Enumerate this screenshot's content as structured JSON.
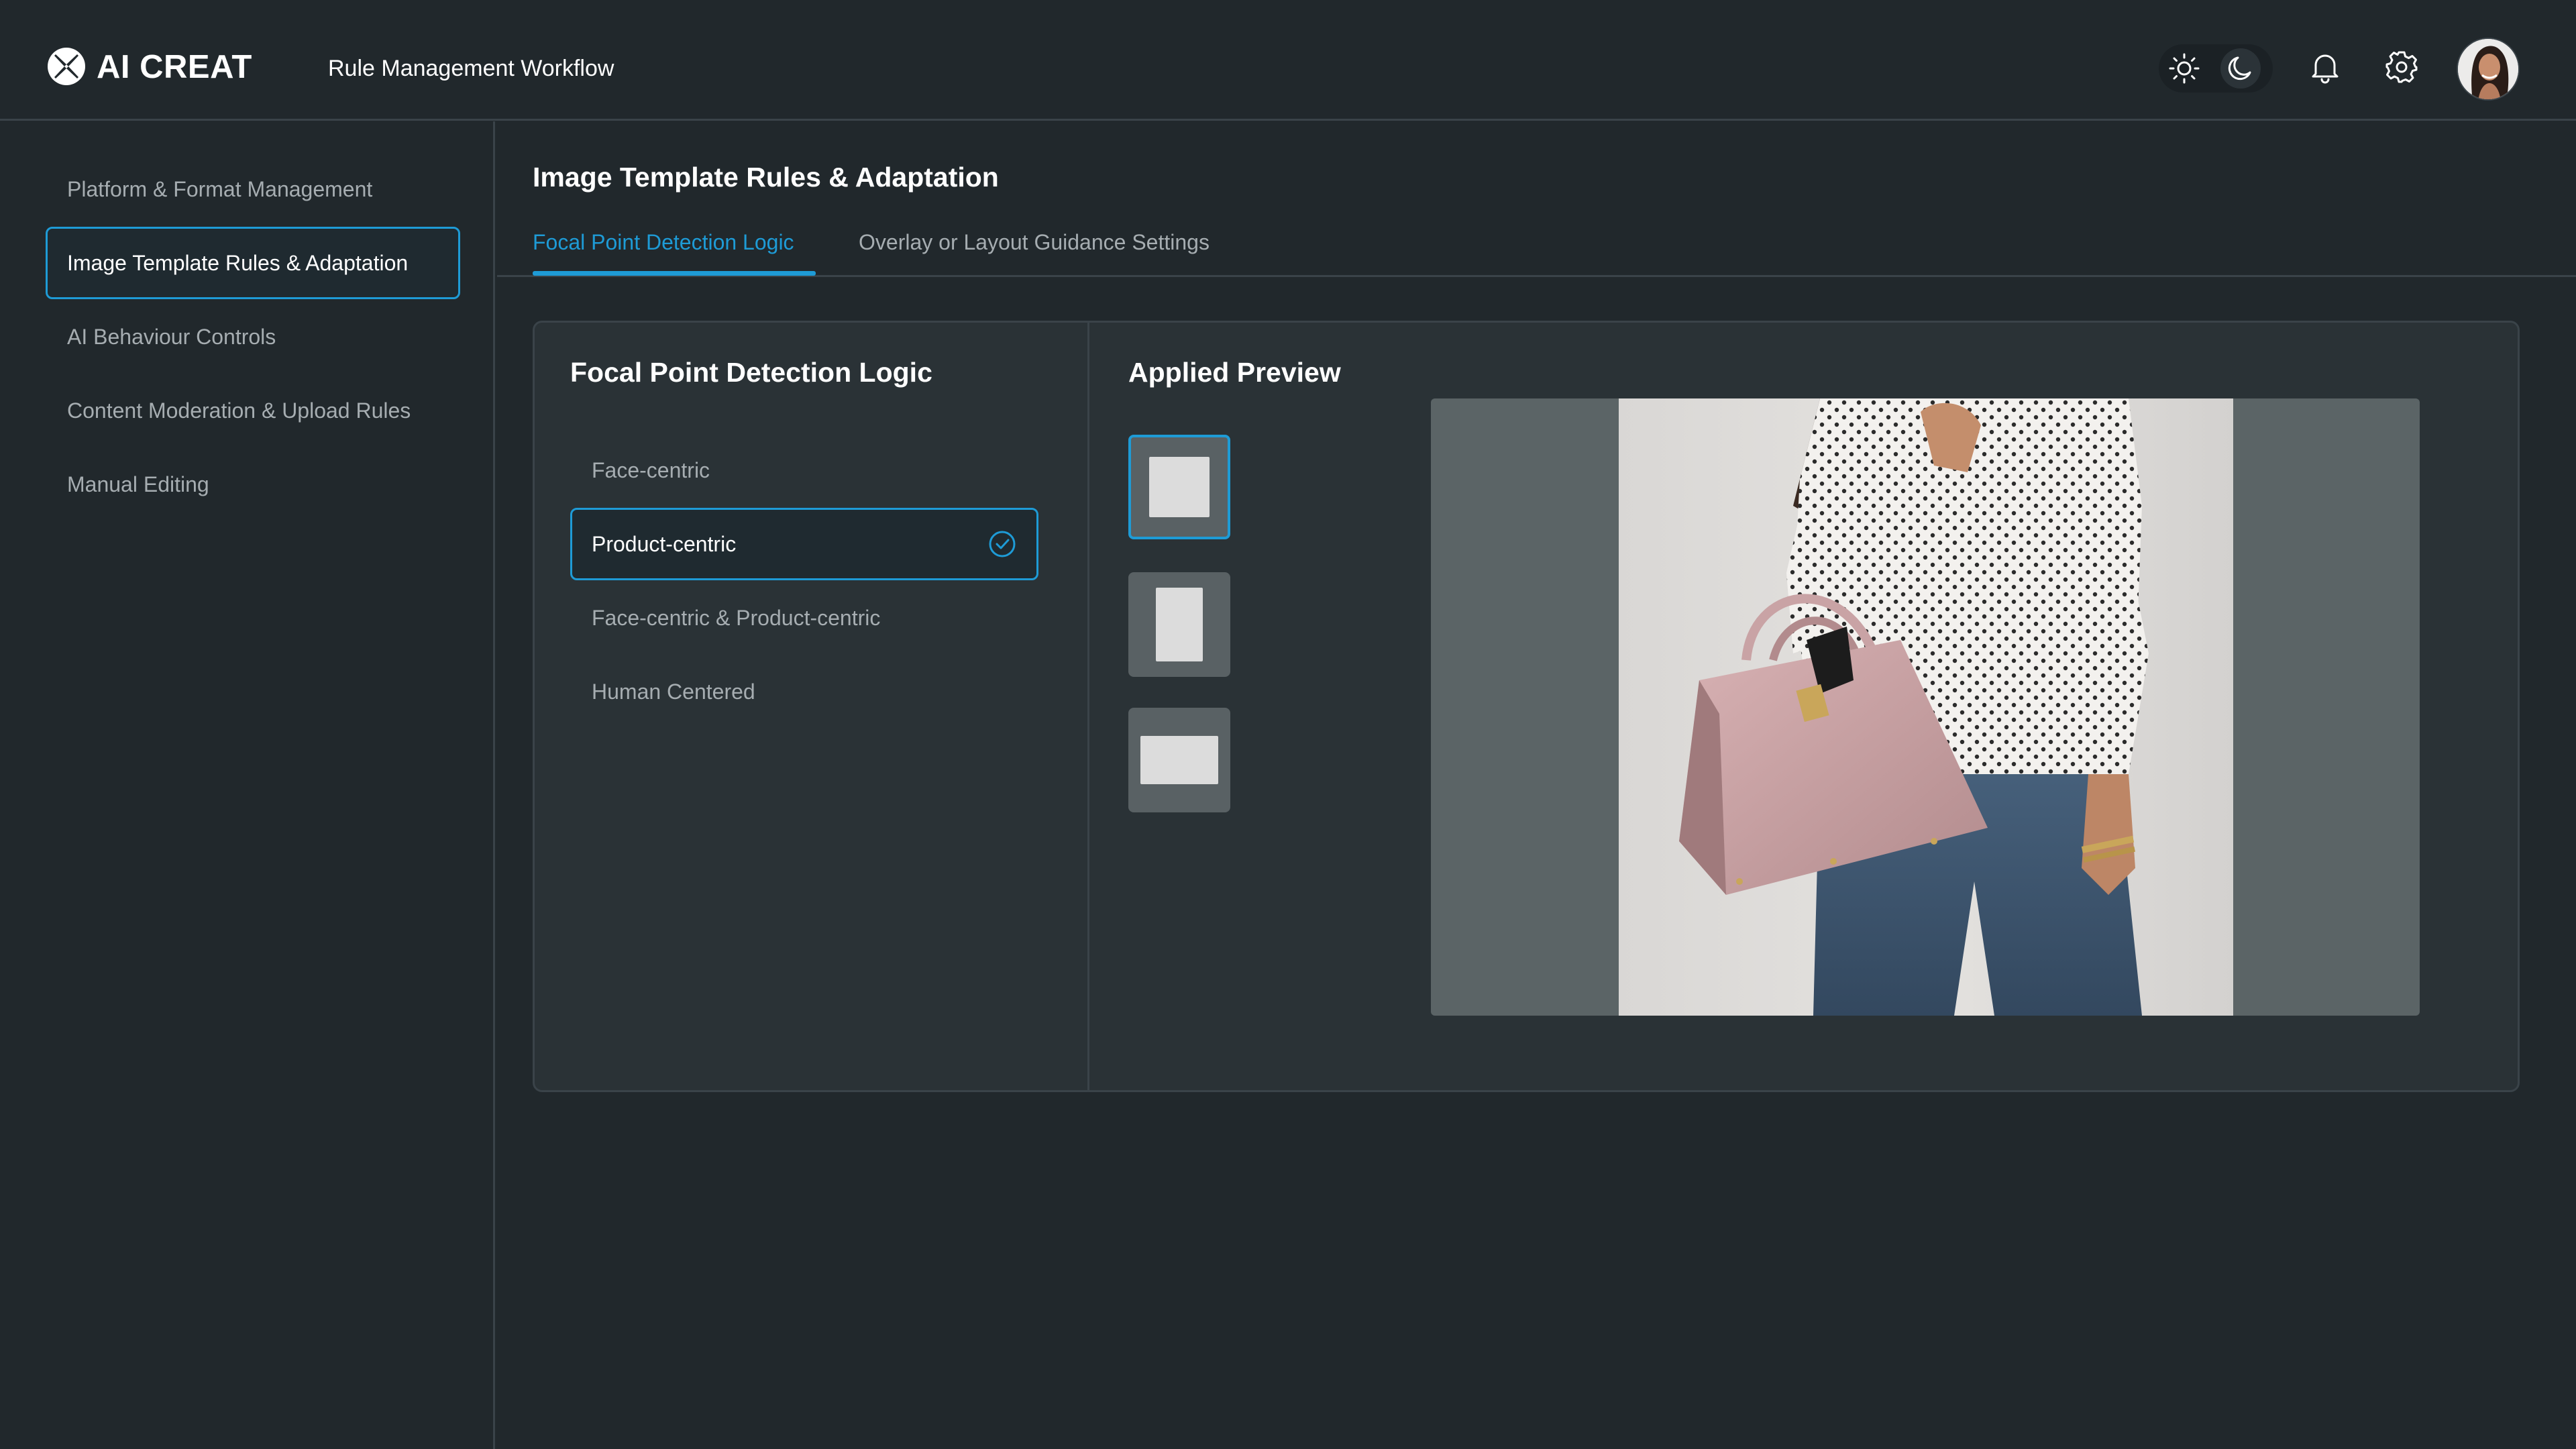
{
  "header": {
    "brand": "AI CREAT",
    "workflow_title": "Rule Management Workflow",
    "icons": [
      "logo-icon",
      "sun-icon",
      "moon-icon",
      "bell-icon",
      "gear-icon"
    ],
    "theme": "dark"
  },
  "sidebar": {
    "items": [
      {
        "label": "Platform & Format Management"
      },
      {
        "label": "Image Template Rules & Adaptation",
        "active": true
      },
      {
        "label": "AI Behaviour Controls"
      },
      {
        "label": "Content Moderation & Upload Rules"
      },
      {
        "label": "Manual Editing"
      }
    ]
  },
  "main": {
    "page_title": "Image Template Rules & Adaptation",
    "tabs": [
      {
        "label": "Focal Point Detection Logic",
        "active": true
      },
      {
        "label": "Overlay or Layout Guidance Settings"
      }
    ],
    "detection": {
      "title": "Focal Point Detection Logic",
      "options": [
        {
          "label": "Face-centric"
        },
        {
          "label": "Product-centric",
          "selected": true
        },
        {
          "label": "Face-centric & Product-centric"
        },
        {
          "label": "Human Centered"
        }
      ]
    },
    "preview": {
      "title": "Applied Preview",
      "ratios": [
        "square",
        "portrait",
        "landscape"
      ],
      "selected_ratio": "square"
    }
  },
  "colors": {
    "background": "#21282c",
    "card": "#2a3236",
    "accent": "#1e9bd6",
    "muted_text": "#a6adb1",
    "border": "#3a4349"
  }
}
